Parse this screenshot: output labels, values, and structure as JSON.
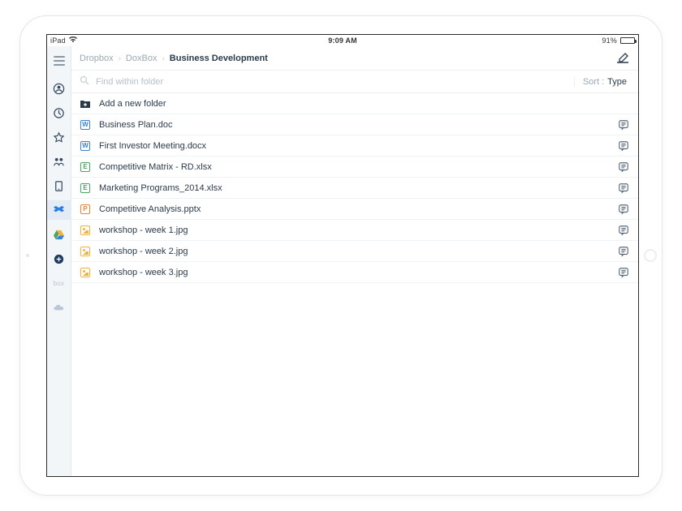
{
  "statusbar": {
    "device": "iPad",
    "time": "9:09 AM",
    "battery_pct": "91%"
  },
  "breadcrumb": [
    {
      "label": "Dropbox",
      "current": false
    },
    {
      "label": "DoxBox",
      "current": false
    },
    {
      "label": "Business Development",
      "current": true
    }
  ],
  "search": {
    "placeholder": "Find within folder"
  },
  "sort": {
    "label": "Sort :",
    "value": "Type"
  },
  "add_folder_label": "Add a new folder",
  "files": [
    {
      "name": "Business Plan.doc",
      "type": "word",
      "letter": "W"
    },
    {
      "name": "First Investor Meeting.docx",
      "type": "word",
      "letter": "W"
    },
    {
      "name": "Competitive Matrix - RD.xlsx",
      "type": "excel",
      "letter": "E"
    },
    {
      "name": "Marketing Programs_2014.xlsx",
      "type": "excel",
      "letter": "E"
    },
    {
      "name": "Competitive Analysis.pptx",
      "type": "ppt",
      "letter": "P"
    },
    {
      "name": "workshop - week 1.jpg",
      "type": "image"
    },
    {
      "name": "workshop - week 2.jpg",
      "type": "image"
    },
    {
      "name": "workshop - week 3.jpg",
      "type": "image"
    }
  ],
  "sidebar": {
    "items": [
      {
        "name": "user-icon"
      },
      {
        "name": "clock-icon"
      },
      {
        "name": "star-icon"
      },
      {
        "name": "people-icon"
      },
      {
        "name": "device-icon"
      },
      {
        "name": "dropbox-icon",
        "active": true
      },
      {
        "name": "google-drive-icon"
      },
      {
        "name": "onedrive-business-icon"
      },
      {
        "name": "box-icon",
        "text": "box"
      },
      {
        "name": "onedrive-icon"
      }
    ]
  }
}
